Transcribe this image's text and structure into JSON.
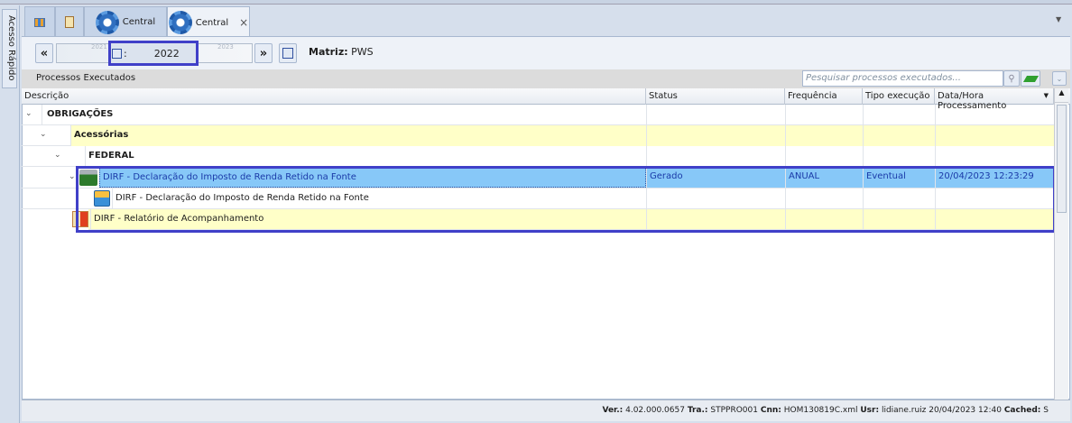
{
  "side_panel": {
    "label": "Acesso Rápido"
  },
  "tabs": [
    {
      "label": "Central"
    },
    {
      "label": "Central",
      "close": "×"
    }
  ],
  "toolbar": {
    "prev": "«",
    "next": "»",
    "year_prev": "2021",
    "year": "2022",
    "year_next": "2023",
    "year_sep": ":",
    "matriz_label": "Matriz:",
    "matriz_value": "PWS"
  },
  "section": {
    "title": "Processos Executados",
    "search_placeholder": "Pesquisar processos executados..."
  },
  "columns": [
    "Descrição",
    "Status",
    "Frequência",
    "Tipo execução",
    "Data/Hora Processamento"
  ],
  "rows": [
    {
      "desc": "OBRIGAÇÕES",
      "status": "",
      "freq": "",
      "tipo": "",
      "data": ""
    },
    {
      "desc": "Acessórias",
      "status": "",
      "freq": "",
      "tipo": "",
      "data": ""
    },
    {
      "desc": "FEDERAL",
      "status": "",
      "freq": "",
      "tipo": "",
      "data": ""
    },
    {
      "desc": "DIRF - Declaração do Imposto de Renda Retido na Fonte",
      "status": "Gerado",
      "freq": "ANUAL",
      "tipo": "Eventual",
      "data": "20/04/2023 12:23:29"
    },
    {
      "desc": "DIRF - Declaração do Imposto de Renda Retido na Fonte",
      "status": "",
      "freq": "",
      "tipo": "",
      "data": ""
    },
    {
      "desc": "DIRF - Relatório de Acompanhamento",
      "status": "",
      "freq": "",
      "tipo": "",
      "data": ""
    }
  ],
  "status_bar": {
    "ver_label": "Ver.:",
    "ver": "4.02.000.0657",
    "tra_label": "Tra.:",
    "tra": "STPPRO001",
    "cnn_label": "Cnn:",
    "cnn": "HOM130819C.xml",
    "usr_label": "Usr:",
    "usr": "lidiane.ruiz",
    "datetime": "20/04/2023 12:40",
    "cached_label": "Cached:",
    "cached": "S"
  }
}
